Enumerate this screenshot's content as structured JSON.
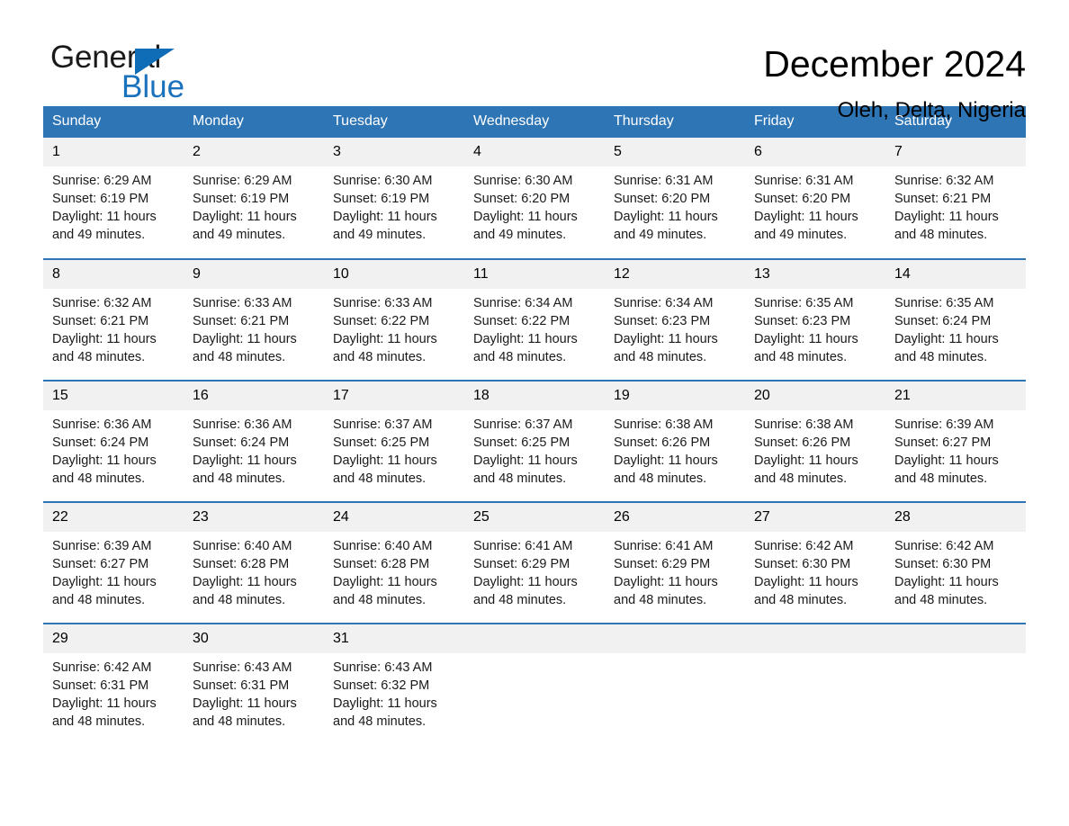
{
  "brand": {
    "name_part1": "General",
    "name_part2": "Blue",
    "logo_icon": "triangle-flag-icon",
    "accent_color": "#1a72bd"
  },
  "header": {
    "title": "December 2024",
    "location": "Oleh, Delta, Nigeria"
  },
  "theme": {
    "header_row_bg": "#2e75b6",
    "header_row_text": "#ffffff",
    "daynum_bg": "#f1f1f1",
    "row_border": "#2e75b6",
    "page_bg": "#ffffff"
  },
  "weekdays": [
    "Sunday",
    "Monday",
    "Tuesday",
    "Wednesday",
    "Thursday",
    "Friday",
    "Saturday"
  ],
  "weeks": [
    [
      {
        "day": "1",
        "sunrise": "Sunrise: 6:29 AM",
        "sunset": "Sunset: 6:19 PM",
        "daylight_line1": "Daylight: 11 hours",
        "daylight_line2": "and 49 minutes."
      },
      {
        "day": "2",
        "sunrise": "Sunrise: 6:29 AM",
        "sunset": "Sunset: 6:19 PM",
        "daylight_line1": "Daylight: 11 hours",
        "daylight_line2": "and 49 minutes."
      },
      {
        "day": "3",
        "sunrise": "Sunrise: 6:30 AM",
        "sunset": "Sunset: 6:19 PM",
        "daylight_line1": "Daylight: 11 hours",
        "daylight_line2": "and 49 minutes."
      },
      {
        "day": "4",
        "sunrise": "Sunrise: 6:30 AM",
        "sunset": "Sunset: 6:20 PM",
        "daylight_line1": "Daylight: 11 hours",
        "daylight_line2": "and 49 minutes."
      },
      {
        "day": "5",
        "sunrise": "Sunrise: 6:31 AM",
        "sunset": "Sunset: 6:20 PM",
        "daylight_line1": "Daylight: 11 hours",
        "daylight_line2": "and 49 minutes."
      },
      {
        "day": "6",
        "sunrise": "Sunrise: 6:31 AM",
        "sunset": "Sunset: 6:20 PM",
        "daylight_line1": "Daylight: 11 hours",
        "daylight_line2": "and 49 minutes."
      },
      {
        "day": "7",
        "sunrise": "Sunrise: 6:32 AM",
        "sunset": "Sunset: 6:21 PM",
        "daylight_line1": "Daylight: 11 hours",
        "daylight_line2": "and 48 minutes."
      }
    ],
    [
      {
        "day": "8",
        "sunrise": "Sunrise: 6:32 AM",
        "sunset": "Sunset: 6:21 PM",
        "daylight_line1": "Daylight: 11 hours",
        "daylight_line2": "and 48 minutes."
      },
      {
        "day": "9",
        "sunrise": "Sunrise: 6:33 AM",
        "sunset": "Sunset: 6:21 PM",
        "daylight_line1": "Daylight: 11 hours",
        "daylight_line2": "and 48 minutes."
      },
      {
        "day": "10",
        "sunrise": "Sunrise: 6:33 AM",
        "sunset": "Sunset: 6:22 PM",
        "daylight_line1": "Daylight: 11 hours",
        "daylight_line2": "and 48 minutes."
      },
      {
        "day": "11",
        "sunrise": "Sunrise: 6:34 AM",
        "sunset": "Sunset: 6:22 PM",
        "daylight_line1": "Daylight: 11 hours",
        "daylight_line2": "and 48 minutes."
      },
      {
        "day": "12",
        "sunrise": "Sunrise: 6:34 AM",
        "sunset": "Sunset: 6:23 PM",
        "daylight_line1": "Daylight: 11 hours",
        "daylight_line2": "and 48 minutes."
      },
      {
        "day": "13",
        "sunrise": "Sunrise: 6:35 AM",
        "sunset": "Sunset: 6:23 PM",
        "daylight_line1": "Daylight: 11 hours",
        "daylight_line2": "and 48 minutes."
      },
      {
        "day": "14",
        "sunrise": "Sunrise: 6:35 AM",
        "sunset": "Sunset: 6:24 PM",
        "daylight_line1": "Daylight: 11 hours",
        "daylight_line2": "and 48 minutes."
      }
    ],
    [
      {
        "day": "15",
        "sunrise": "Sunrise: 6:36 AM",
        "sunset": "Sunset: 6:24 PM",
        "daylight_line1": "Daylight: 11 hours",
        "daylight_line2": "and 48 minutes."
      },
      {
        "day": "16",
        "sunrise": "Sunrise: 6:36 AM",
        "sunset": "Sunset: 6:24 PM",
        "daylight_line1": "Daylight: 11 hours",
        "daylight_line2": "and 48 minutes."
      },
      {
        "day": "17",
        "sunrise": "Sunrise: 6:37 AM",
        "sunset": "Sunset: 6:25 PM",
        "daylight_line1": "Daylight: 11 hours",
        "daylight_line2": "and 48 minutes."
      },
      {
        "day": "18",
        "sunrise": "Sunrise: 6:37 AM",
        "sunset": "Sunset: 6:25 PM",
        "daylight_line1": "Daylight: 11 hours",
        "daylight_line2": "and 48 minutes."
      },
      {
        "day": "19",
        "sunrise": "Sunrise: 6:38 AM",
        "sunset": "Sunset: 6:26 PM",
        "daylight_line1": "Daylight: 11 hours",
        "daylight_line2": "and 48 minutes."
      },
      {
        "day": "20",
        "sunrise": "Sunrise: 6:38 AM",
        "sunset": "Sunset: 6:26 PM",
        "daylight_line1": "Daylight: 11 hours",
        "daylight_line2": "and 48 minutes."
      },
      {
        "day": "21",
        "sunrise": "Sunrise: 6:39 AM",
        "sunset": "Sunset: 6:27 PM",
        "daylight_line1": "Daylight: 11 hours",
        "daylight_line2": "and 48 minutes."
      }
    ],
    [
      {
        "day": "22",
        "sunrise": "Sunrise: 6:39 AM",
        "sunset": "Sunset: 6:27 PM",
        "daylight_line1": "Daylight: 11 hours",
        "daylight_line2": "and 48 minutes."
      },
      {
        "day": "23",
        "sunrise": "Sunrise: 6:40 AM",
        "sunset": "Sunset: 6:28 PM",
        "daylight_line1": "Daylight: 11 hours",
        "daylight_line2": "and 48 minutes."
      },
      {
        "day": "24",
        "sunrise": "Sunrise: 6:40 AM",
        "sunset": "Sunset: 6:28 PM",
        "daylight_line1": "Daylight: 11 hours",
        "daylight_line2": "and 48 minutes."
      },
      {
        "day": "25",
        "sunrise": "Sunrise: 6:41 AM",
        "sunset": "Sunset: 6:29 PM",
        "daylight_line1": "Daylight: 11 hours",
        "daylight_line2": "and 48 minutes."
      },
      {
        "day": "26",
        "sunrise": "Sunrise: 6:41 AM",
        "sunset": "Sunset: 6:29 PM",
        "daylight_line1": "Daylight: 11 hours",
        "daylight_line2": "and 48 minutes."
      },
      {
        "day": "27",
        "sunrise": "Sunrise: 6:42 AM",
        "sunset": "Sunset: 6:30 PM",
        "daylight_line1": "Daylight: 11 hours",
        "daylight_line2": "and 48 minutes."
      },
      {
        "day": "28",
        "sunrise": "Sunrise: 6:42 AM",
        "sunset": "Sunset: 6:30 PM",
        "daylight_line1": "Daylight: 11 hours",
        "daylight_line2": "and 48 minutes."
      }
    ],
    [
      {
        "day": "29",
        "sunrise": "Sunrise: 6:42 AM",
        "sunset": "Sunset: 6:31 PM",
        "daylight_line1": "Daylight: 11 hours",
        "daylight_line2": "and 48 minutes."
      },
      {
        "day": "30",
        "sunrise": "Sunrise: 6:43 AM",
        "sunset": "Sunset: 6:31 PM",
        "daylight_line1": "Daylight: 11 hours",
        "daylight_line2": "and 48 minutes."
      },
      {
        "day": "31",
        "sunrise": "Sunrise: 6:43 AM",
        "sunset": "Sunset: 6:32 PM",
        "daylight_line1": "Daylight: 11 hours",
        "daylight_line2": "and 48 minutes."
      },
      {
        "day": "",
        "sunrise": "",
        "sunset": "",
        "daylight_line1": "",
        "daylight_line2": ""
      },
      {
        "day": "",
        "sunrise": "",
        "sunset": "",
        "daylight_line1": "",
        "daylight_line2": ""
      },
      {
        "day": "",
        "sunrise": "",
        "sunset": "",
        "daylight_line1": "",
        "daylight_line2": ""
      },
      {
        "day": "",
        "sunrise": "",
        "sunset": "",
        "daylight_line1": "",
        "daylight_line2": ""
      }
    ]
  ]
}
